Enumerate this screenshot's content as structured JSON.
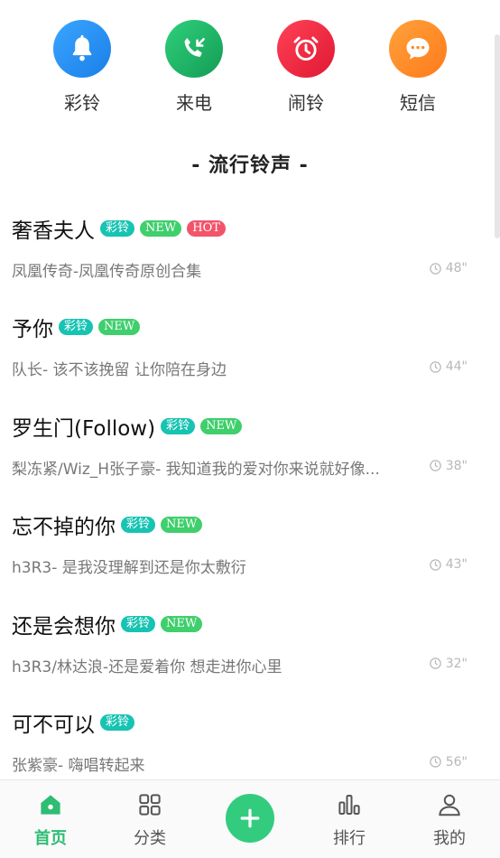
{
  "categories": [
    {
      "label": "彩铃",
      "icon": "bell-icon",
      "color": "#1f8ff7"
    },
    {
      "label": "来电",
      "icon": "incoming-call-icon",
      "color": "#1dbb6a"
    },
    {
      "label": "闹铃",
      "icon": "alarm-clock-icon",
      "color": "#f0263e"
    },
    {
      "label": "短信",
      "icon": "message-icon",
      "color": "#ff8c28"
    }
  ],
  "section_title": "- 流行铃声 -",
  "songs": [
    {
      "title": "奢香夫人",
      "badges": [
        "彩铃",
        "NEW",
        "HOT"
      ],
      "subtitle": "凤凰传奇-凤凰传奇原创合集",
      "duration": "48\""
    },
    {
      "title": "予你",
      "badges": [
        "彩铃",
        "NEW"
      ],
      "subtitle": "队长- 该不该挽留 让你陪在身边",
      "duration": "44\""
    },
    {
      "title": "罗生门(Follow)",
      "badges": [
        "彩铃",
        "NEW"
      ],
      "subtitle": "梨冻紧/Wiz_H张子豪- 我知道我的爱对你来说就好像...",
      "duration": "38\""
    },
    {
      "title": "忘不掉的你",
      "badges": [
        "彩铃",
        "NEW"
      ],
      "subtitle": "h3R3- 是我没理解到还是你太敷衍",
      "duration": "43\""
    },
    {
      "title": "还是会想你",
      "badges": [
        "彩铃",
        "NEW"
      ],
      "subtitle": "h3R3/林达浪-还是爱着你 想走进你心里",
      "duration": "32\""
    },
    {
      "title": "可不可以",
      "badges": [
        "彩铃"
      ],
      "subtitle": "张紫豪- 嗨唱转起来",
      "duration": "56\""
    }
  ],
  "nav": {
    "home": "首页",
    "category": "分类",
    "rank": "排行",
    "mine": "我的",
    "active_color": "#2dbd73"
  }
}
